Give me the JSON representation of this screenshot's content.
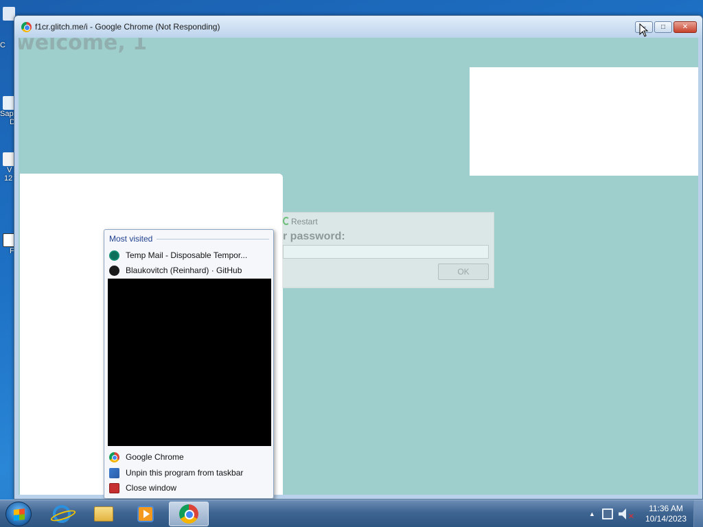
{
  "desktop": {
    "icon_fragments": [
      "C",
      "Sap",
      "D",
      "V",
      "12",
      "F"
    ]
  },
  "window": {
    "title": "f1cr.glitch.me/i - Google Chrome (Not Responding)",
    "buttons": {
      "minimize": "–",
      "maximize": "□",
      "close": "✕"
    }
  },
  "page": {
    "welcome_text": "welcome, 1",
    "dialog": {
      "restart_label": "Restart",
      "password_label": "r password:",
      "password_value": "",
      "ok_label": "OK"
    }
  },
  "jumplist": {
    "header": "Most visited",
    "most_visited": [
      {
        "label": "Temp Mail - Disposable Tempor...",
        "icon": "temp-mail-icon"
      },
      {
        "label": "Blaukovitch (Reinhard) · GitHub",
        "icon": "github-icon"
      }
    ],
    "tasks": [
      {
        "label": "Google Chrome",
        "icon": "chrome-icon"
      },
      {
        "label": "Unpin this program from taskbar",
        "icon": "unpin-icon"
      },
      {
        "label": "Close window",
        "icon": "close-window-icon"
      }
    ]
  },
  "taskbar": {
    "apps": [
      "internet-explorer",
      "windows-explorer",
      "windows-media-player",
      "google-chrome"
    ],
    "active_app": "google-chrome",
    "clock_time": "11:36 AM",
    "clock_date": "10/14/2023",
    "tray_arrow": "▲",
    "volume_muted_mark": "✕"
  }
}
